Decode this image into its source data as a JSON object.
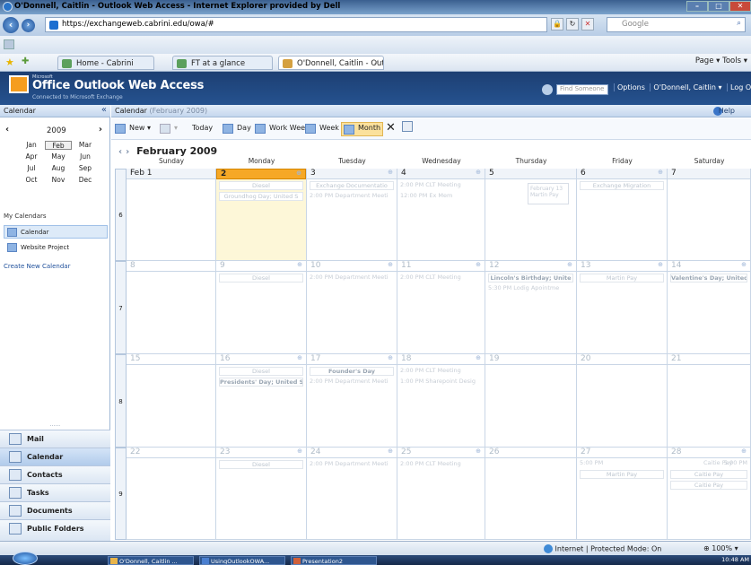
{
  "window": {
    "title": "O'Donnell, Caitlin - Outlook Web Access - Internet Explorer provided by Dell"
  },
  "browser": {
    "url": "https://exchangeweb.cabrini.edu/owa/#",
    "search_placeholder": "Google",
    "tabs": [
      "Home - Cabrini",
      "FT at a glance",
      "O'Donnell, Caitlin - Out..."
    ],
    "tools_right": "Page ▾   Tools ▾"
  },
  "owa": {
    "logo_ms": "Microsoft",
    "logo": "Office Outlook Web Access",
    "logo_sub": "Connected to Microsoft Exchange",
    "find_placeholder": "Find Someone",
    "options": "Options",
    "user": "O'Donnell, Caitlin ▾",
    "logoff": "Log O"
  },
  "left": {
    "heading": "Calendar",
    "year": "2009",
    "months": [
      "Jan",
      "Feb",
      "Mar",
      "Apr",
      "May",
      "Jun",
      "Jul",
      "Aug",
      "Sep",
      "Oct",
      "Nov",
      "Dec"
    ],
    "my_calendars": "My Calendars",
    "calendars": [
      "Calendar",
      "Website Project"
    ],
    "create": "Create New Calendar",
    "nav": [
      "Mail",
      "Calendar",
      "Contacts",
      "Tasks",
      "Documents",
      "Public Folders"
    ]
  },
  "calendar": {
    "heading": "Calendar",
    "heading_sub": "(February 2009)",
    "help": "Help",
    "toolbar": {
      "new": "New",
      "today": "Today",
      "day": "Day",
      "work_week": "Work Week",
      "week": "Week",
      "month": "Month"
    },
    "month_title": "February 2009",
    "days": [
      "Sunday",
      "Monday",
      "Tuesday",
      "Wednesday",
      "Thursday",
      "Friday",
      "Saturday"
    ],
    "weeks": [
      {
        "num": "6",
        "dates": [
          "Feb 1",
          "2",
          "3",
          "4",
          "5",
          "6",
          "7"
        ]
      },
      {
        "num": "7",
        "dates": [
          "8",
          "9",
          "10",
          "11",
          "12",
          "13",
          "14"
        ]
      },
      {
        "num": "8",
        "dates": [
          "15",
          "16",
          "17",
          "18",
          "19",
          "20",
          "21"
        ]
      },
      {
        "num": "9",
        "dates": [
          "22",
          "23",
          "24",
          "25",
          "26",
          "27",
          "28"
        ]
      }
    ],
    "events": {
      "w0": [
        "Diesel",
        "Groundhog Day; United S",
        "Exchange Documentatio",
        "2:00 PM  Department Meeti",
        "2:00 PM  CLT Meeting",
        "12:00 PM  Ex Mem",
        "Exchange Migration"
      ],
      "w1": [
        "Diesel",
        "2:00 PM  Department Meeti",
        "2:00 PM  CLT Meeting",
        "Lincoln's Birthday; Unite",
        "5:30 PM  Lodig Apointme",
        "Martin Pay",
        "Valentine's Day; United S"
      ],
      "w2": [
        "Diesel",
        "Presidents' Day; United S",
        "Founder's Day",
        "2:00 PM  Department Meeti",
        "2:00 PM  CLT Meeting",
        "1:00 PM  Sharepoint Desig"
      ],
      "w3": [
        "Diesel",
        "2:00 PM  Department Meeti",
        "2:00 PM  CLT Meeting",
        "5:00 PM",
        "Caitie Pay",
        "5:00 PM",
        "Martin Pay",
        "Caitie Pay",
        "Caitie Pay"
      ]
    },
    "popup": [
      "February 13",
      "Martin Pay"
    ]
  },
  "status": {
    "zone": "Internet | Protected Mode: On",
    "zoom": "100%"
  },
  "taskbar": {
    "items": [
      "O'Donnell, Caitlin ...",
      "UsingOutlookOWA...",
      "Presentation2"
    ],
    "time": "10:48 AM"
  }
}
